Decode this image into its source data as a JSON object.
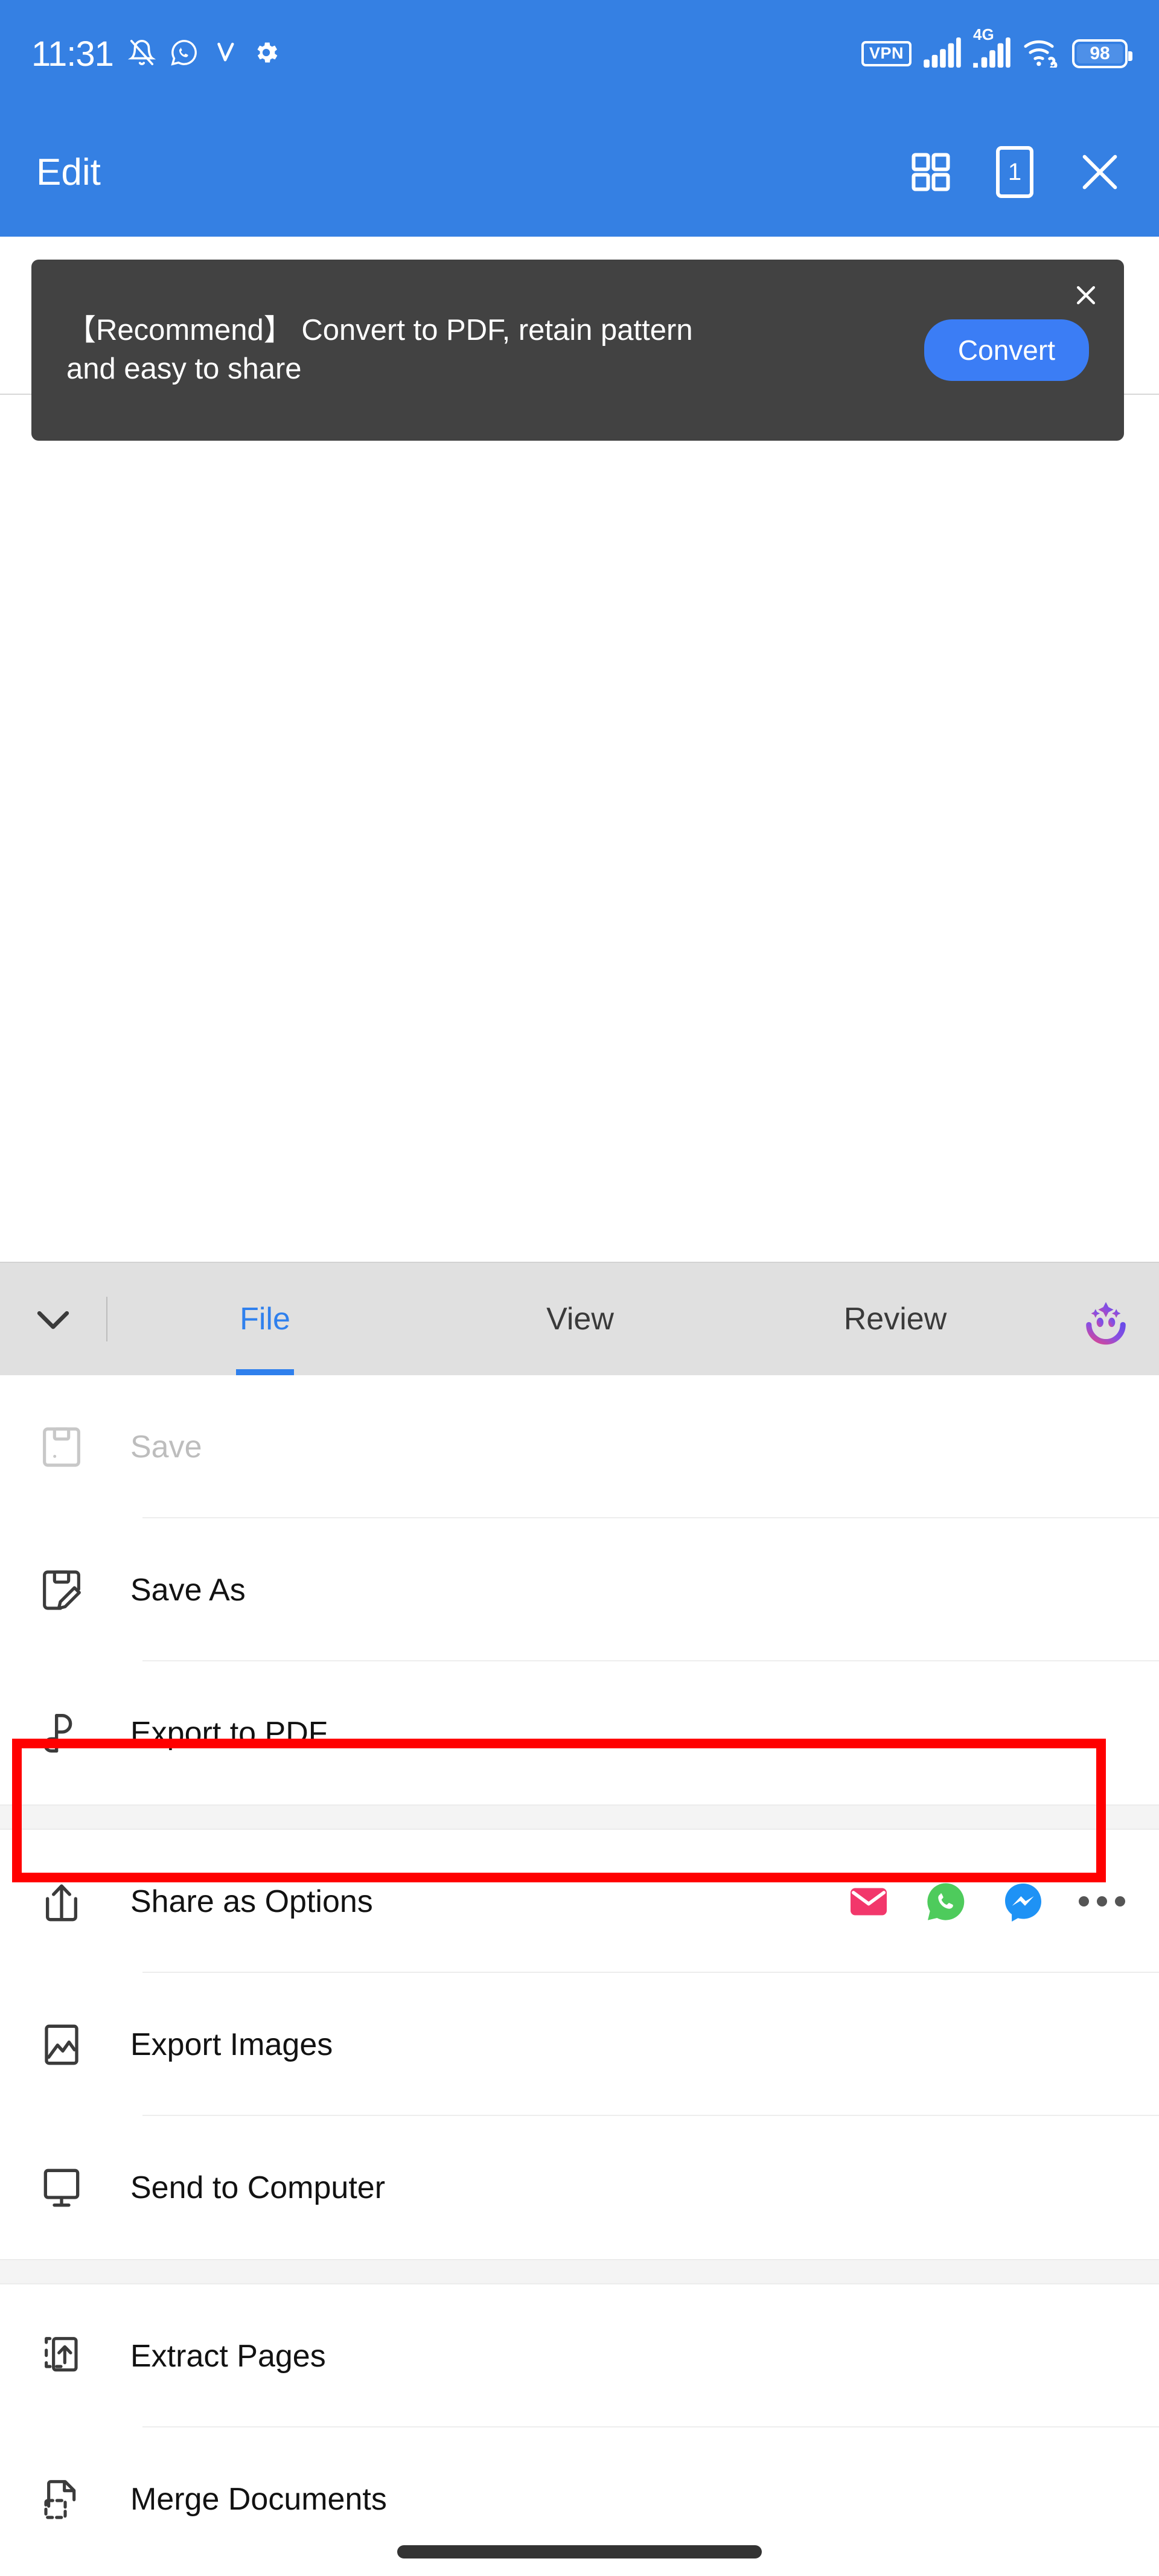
{
  "status_bar": {
    "time": "11:31",
    "left_icons": [
      "bell-muted-icon",
      "whatsapp-icon",
      "checkmark-icon",
      "gear-icon"
    ],
    "vpn_label": "VPN",
    "network_label": "4G",
    "right_icons": [
      "vpn-badge",
      "signal-bars-icon",
      "signal-bars-4g-icon",
      "wifi-link-icon",
      "battery-icon"
    ],
    "battery_level": "98"
  },
  "header": {
    "title": "Edit",
    "grid_icon": "grid-view-icon",
    "page_count": "1",
    "close_icon": "close-icon"
  },
  "banner": {
    "text": "【Recommend】 Convert to PDF, retain pattern and easy to share",
    "button_label": "Convert",
    "close_icon": "close-icon",
    "bg_color": "#424242",
    "button_color": "#3B7DF5"
  },
  "tabbar": {
    "collapse_icon": "chevron-down-icon",
    "ai_icon": "ai-sparkle-face-icon",
    "active_index": 0,
    "accent_color": "#2F80ED",
    "tabs": [
      {
        "label": "File",
        "active": true
      },
      {
        "label": "View",
        "active": false
      },
      {
        "label": "Review",
        "active": false
      }
    ]
  },
  "menu": {
    "items": [
      {
        "label": "Save",
        "icon": "save-disk-icon",
        "disabled": true,
        "section": 1
      },
      {
        "label": "Save As",
        "icon": "save-as-disk-icon",
        "disabled": false,
        "section": 1
      },
      {
        "label": "Export to PDF",
        "icon": "pdf-export-icon",
        "disabled": false,
        "section": 1,
        "highlighted": true
      },
      {
        "label": "Share as Options",
        "icon": "share-arrow-icon",
        "disabled": false,
        "section": 2,
        "share_icons": [
          "email-icon",
          "whatsapp-icon",
          "messenger-icon",
          "more-dots-icon"
        ]
      },
      {
        "label": "Export Images",
        "icon": "image-export-icon",
        "disabled": false,
        "section": 2
      },
      {
        "label": "Send to Computer",
        "icon": "monitor-icon",
        "disabled": false,
        "section": 2
      },
      {
        "label": "Extract Pages",
        "icon": "extract-pages-icon",
        "disabled": false,
        "section": 3
      },
      {
        "label": "Merge Documents",
        "icon": "merge-documents-icon",
        "disabled": false,
        "section": 3
      }
    ]
  },
  "annotation": {
    "highlight_target": "Export to PDF",
    "highlight_color": "#FF0000"
  }
}
